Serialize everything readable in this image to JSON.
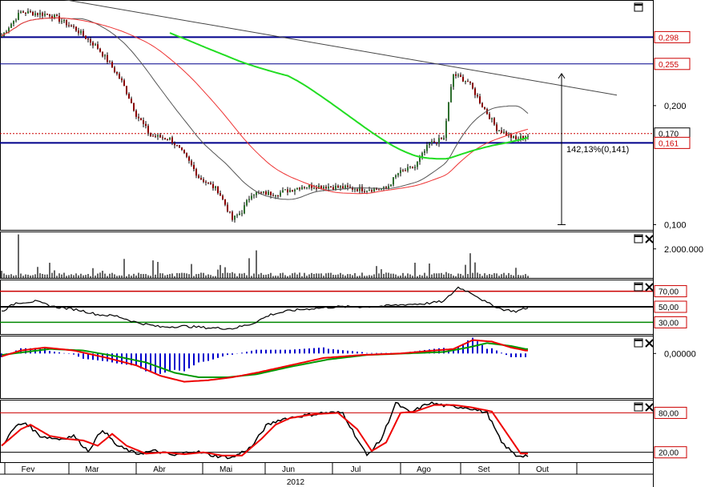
{
  "chart_data": [
    {
      "type": "candlestick",
      "panel": "price",
      "y_scale": "log",
      "ylim": [
        0.097,
        0.37
      ],
      "y_ticks": [
        "0,200",
        "0,100"
      ],
      "price_tags": [
        {
          "label": "0,298",
          "value": 0.298,
          "color": "#cc0000"
        },
        {
          "label": "0,255",
          "value": 0.255,
          "color": "#cc0000"
        },
        {
          "label": "0,170",
          "value": 0.17,
          "color": "#000000"
        },
        {
          "label": "0,161",
          "value": 0.161,
          "color": "#cc0000"
        }
      ],
      "horizontal_lines": [
        {
          "value": 0.298,
          "color": "#00008b"
        },
        {
          "value": 0.255,
          "color": "#00008b"
        },
        {
          "value": 0.17,
          "color": "#cc0000",
          "style": "dotted"
        },
        {
          "value": 0.161,
          "color": "#00008b"
        }
      ],
      "annotation": "142,13%(0,141)",
      "measure_from": 0.1,
      "measure_to": 0.241,
      "trendline": {
        "from_value": 0.395,
        "to_value": 0.215
      },
      "ohlc_series": {
        "start": [
          0.305,
          0.3,
          0.298
        ],
        "keypoints": [
          {
            "i": 0,
            "v": 0.3
          },
          {
            "i": 8,
            "v": 0.345
          },
          {
            "i": 20,
            "v": 0.34
          },
          {
            "i": 30,
            "v": 0.315
          },
          {
            "i": 40,
            "v": 0.28
          },
          {
            "i": 50,
            "v": 0.23
          },
          {
            "i": 56,
            "v": 0.19
          },
          {
            "i": 62,
            "v": 0.168
          },
          {
            "i": 70,
            "v": 0.165
          },
          {
            "i": 76,
            "v": 0.15
          },
          {
            "i": 82,
            "v": 0.132
          },
          {
            "i": 90,
            "v": 0.122
          },
          {
            "i": 96,
            "v": 0.103
          },
          {
            "i": 100,
            "v": 0.108
          },
          {
            "i": 104,
            "v": 0.12
          },
          {
            "i": 115,
            "v": 0.12
          },
          {
            "i": 125,
            "v": 0.125
          },
          {
            "i": 135,
            "v": 0.125
          },
          {
            "i": 150,
            "v": 0.123
          },
          {
            "i": 160,
            "v": 0.123
          },
          {
            "i": 165,
            "v": 0.135
          },
          {
            "i": 172,
            "v": 0.14
          },
          {
            "i": 178,
            "v": 0.16
          },
          {
            "i": 184,
            "v": 0.165
          },
          {
            "i": 188,
            "v": 0.24
          },
          {
            "i": 194,
            "v": 0.23
          },
          {
            "i": 200,
            "v": 0.2
          },
          {
            "i": 206,
            "v": 0.175
          },
          {
            "i": 214,
            "v": 0.164
          },
          {
            "i": 218,
            "v": 0.168
          }
        ]
      }
    },
    {
      "type": "bar",
      "panel": "volume",
      "y_ticks": [
        "2.000.000"
      ],
      "ylim": [
        0,
        3200000
      ]
    },
    {
      "type": "line",
      "panel": "rsi",
      "y_ticks": [
        "70,00",
        "50,00",
        "30,00"
      ],
      "ylim": [
        15,
        85
      ],
      "levels": [
        70,
        50,
        30
      ],
      "keypoints": [
        {
          "i": 0,
          "v": 44
        },
        {
          "i": 6,
          "v": 55
        },
        {
          "i": 14,
          "v": 57
        },
        {
          "i": 22,
          "v": 50
        },
        {
          "i": 32,
          "v": 46
        },
        {
          "i": 40,
          "v": 40
        },
        {
          "i": 48,
          "v": 38
        },
        {
          "i": 56,
          "v": 30
        },
        {
          "i": 66,
          "v": 24
        },
        {
          "i": 76,
          "v": 25
        },
        {
          "i": 86,
          "v": 23
        },
        {
          "i": 96,
          "v": 22
        },
        {
          "i": 104,
          "v": 28
        },
        {
          "i": 112,
          "v": 40
        },
        {
          "i": 120,
          "v": 45
        },
        {
          "i": 130,
          "v": 48
        },
        {
          "i": 140,
          "v": 50
        },
        {
          "i": 150,
          "v": 50
        },
        {
          "i": 160,
          "v": 51
        },
        {
          "i": 168,
          "v": 53
        },
        {
          "i": 176,
          "v": 54
        },
        {
          "i": 184,
          "v": 57
        },
        {
          "i": 190,
          "v": 75
        },
        {
          "i": 196,
          "v": 67
        },
        {
          "i": 202,
          "v": 55
        },
        {
          "i": 208,
          "v": 47
        },
        {
          "i": 214,
          "v": 44
        },
        {
          "i": 218,
          "v": 48
        }
      ]
    },
    {
      "type": "line",
      "panel": "macd",
      "y_ticks": [
        "0,00000"
      ],
      "ylim": [
        -0.03,
        0.012
      ],
      "macd_keypoints": [
        {
          "i": 0,
          "v": -0.002
        },
        {
          "i": 8,
          "v": 0.002
        },
        {
          "i": 18,
          "v": 0.004
        },
        {
          "i": 30,
          "v": 0.002
        },
        {
          "i": 44,
          "v": -0.003
        },
        {
          "i": 56,
          "v": -0.008
        },
        {
          "i": 66,
          "v": -0.015
        },
        {
          "i": 76,
          "v": -0.019
        },
        {
          "i": 86,
          "v": -0.018
        },
        {
          "i": 96,
          "v": -0.016
        },
        {
          "i": 106,
          "v": -0.013
        },
        {
          "i": 120,
          "v": -0.008
        },
        {
          "i": 134,
          "v": -0.003
        },
        {
          "i": 150,
          "v": -0.001
        },
        {
          "i": 166,
          "v": 0.0
        },
        {
          "i": 180,
          "v": 0.002
        },
        {
          "i": 188,
          "v": 0.003
        },
        {
          "i": 196,
          "v": 0.009
        },
        {
          "i": 204,
          "v": 0.008
        },
        {
          "i": 212,
          "v": 0.004
        },
        {
          "i": 218,
          "v": 0.002
        }
      ],
      "signal_keypoints": [
        {
          "i": 0,
          "v": -0.001
        },
        {
          "i": 10,
          "v": 0.001
        },
        {
          "i": 20,
          "v": 0.003
        },
        {
          "i": 34,
          "v": 0.002
        },
        {
          "i": 48,
          "v": -0.002
        },
        {
          "i": 60,
          "v": -0.006
        },
        {
          "i": 72,
          "v": -0.013
        },
        {
          "i": 82,
          "v": -0.016
        },
        {
          "i": 94,
          "v": -0.016
        },
        {
          "i": 106,
          "v": -0.014
        },
        {
          "i": 120,
          "v": -0.009
        },
        {
          "i": 136,
          "v": -0.004
        },
        {
          "i": 152,
          "v": -0.001
        },
        {
          "i": 168,
          "v": 0.0
        },
        {
          "i": 184,
          "v": 0.001
        },
        {
          "i": 194,
          "v": 0.004
        },
        {
          "i": 202,
          "v": 0.007
        },
        {
          "i": 212,
          "v": 0.005
        },
        {
          "i": 218,
          "v": 0.003
        }
      ]
    },
    {
      "type": "line",
      "panel": "stochastic",
      "y_ticks": [
        "80,00",
        "20,00"
      ],
      "ylim": [
        5,
        100
      ],
      "levels": [
        80,
        20
      ],
      "k_keypoints": [
        {
          "i": 0,
          "v": 30
        },
        {
          "i": 6,
          "v": 60
        },
        {
          "i": 10,
          "v": 65
        },
        {
          "i": 16,
          "v": 45
        },
        {
          "i": 24,
          "v": 40
        },
        {
          "i": 30,
          "v": 45
        },
        {
          "i": 36,
          "v": 22
        },
        {
          "i": 42,
          "v": 55
        },
        {
          "i": 48,
          "v": 30
        },
        {
          "i": 56,
          "v": 18
        },
        {
          "i": 64,
          "v": 22
        },
        {
          "i": 72,
          "v": 15
        },
        {
          "i": 80,
          "v": 22
        },
        {
          "i": 88,
          "v": 15
        },
        {
          "i": 96,
          "v": 12
        },
        {
          "i": 104,
          "v": 28
        },
        {
          "i": 110,
          "v": 60
        },
        {
          "i": 116,
          "v": 70
        },
        {
          "i": 124,
          "v": 75
        },
        {
          "i": 134,
          "v": 80
        },
        {
          "i": 142,
          "v": 80
        },
        {
          "i": 148,
          "v": 40
        },
        {
          "i": 152,
          "v": 15
        },
        {
          "i": 158,
          "v": 40
        },
        {
          "i": 164,
          "v": 95
        },
        {
          "i": 170,
          "v": 80
        },
        {
          "i": 178,
          "v": 95
        },
        {
          "i": 186,
          "v": 90
        },
        {
          "i": 194,
          "v": 88
        },
        {
          "i": 202,
          "v": 80
        },
        {
          "i": 208,
          "v": 35
        },
        {
          "i": 214,
          "v": 15
        },
        {
          "i": 218,
          "v": 15
        }
      ],
      "d_keypoints": [
        {
          "i": 0,
          "v": 30
        },
        {
          "i": 8,
          "v": 55
        },
        {
          "i": 12,
          "v": 62
        },
        {
          "i": 20,
          "v": 45
        },
        {
          "i": 28,
          "v": 40
        },
        {
          "i": 34,
          "v": 38
        },
        {
          "i": 40,
          "v": 30
        },
        {
          "i": 46,
          "v": 48
        },
        {
          "i": 52,
          "v": 30
        },
        {
          "i": 60,
          "v": 18
        },
        {
          "i": 68,
          "v": 20
        },
        {
          "i": 76,
          "v": 17
        },
        {
          "i": 84,
          "v": 20
        },
        {
          "i": 92,
          "v": 15
        },
        {
          "i": 100,
          "v": 15
        },
        {
          "i": 108,
          "v": 40
        },
        {
          "i": 114,
          "v": 62
        },
        {
          "i": 120,
          "v": 72
        },
        {
          "i": 130,
          "v": 78
        },
        {
          "i": 140,
          "v": 80
        },
        {
          "i": 148,
          "v": 55
        },
        {
          "i": 154,
          "v": 22
        },
        {
          "i": 160,
          "v": 35
        },
        {
          "i": 166,
          "v": 80
        },
        {
          "i": 172,
          "v": 82
        },
        {
          "i": 180,
          "v": 92
        },
        {
          "i": 188,
          "v": 92
        },
        {
          "i": 196,
          "v": 88
        },
        {
          "i": 204,
          "v": 82
        },
        {
          "i": 210,
          "v": 50
        },
        {
          "i": 216,
          "v": 18
        },
        {
          "i": 218,
          "v": 18
        }
      ]
    }
  ],
  "x_axis": {
    "months": [
      "Fev",
      "Mar",
      "Abr",
      "Mai",
      "Jun",
      "Jul",
      "Ago",
      "Set",
      "Out"
    ],
    "year": "2012"
  },
  "colors": {
    "up_candle": "#2f6f2f",
    "down_candle": "#8b0000",
    "ma_short": "#555555",
    "ma_long": "#ee3333",
    "ma_green": "#22dd22",
    "support_line": "#00008b",
    "resistance_line": "#cc0000",
    "rsi_line": "#000000",
    "macd_line": "#ee0000",
    "signal_line": "#009900",
    "hist_bar": "#0000cc"
  },
  "icons": [
    "maximize-icon",
    "close-icon"
  ]
}
